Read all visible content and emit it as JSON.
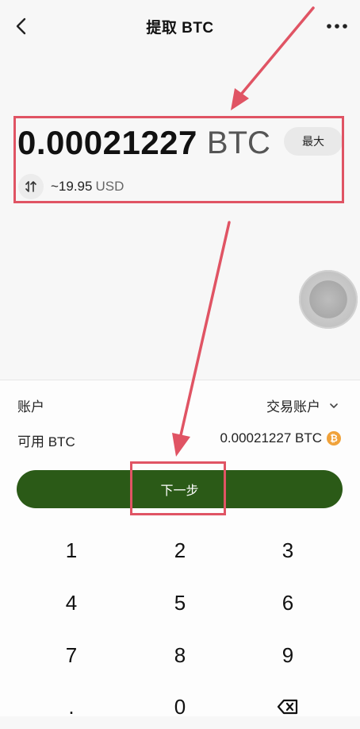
{
  "header": {
    "title": "提取 BTC",
    "back_icon": "chevron-left-icon",
    "more_icon": "more-dots-icon"
  },
  "amount": {
    "value": "0.00021227",
    "unit": "BTC",
    "max_label": "最大",
    "fiat_value": "~19.95",
    "fiat_currency": "USD",
    "swap_icon": "swap-vertical-icon"
  },
  "account": {
    "label": "账户",
    "selected": "交易账户",
    "available_label": "可用 BTC",
    "available_value": "0.00021227 BTC"
  },
  "next_button": {
    "label": "下一步"
  },
  "keypad": {
    "row1": [
      "1",
      "2",
      "3"
    ],
    "row2": [
      "4",
      "5",
      "6"
    ],
    "row3": [
      "7",
      "8",
      "9"
    ],
    "row4": [
      ".",
      "0",
      "backspace-icon"
    ]
  },
  "colors": {
    "primary_green": "#2b5a17",
    "annotation_red": "#e05464",
    "btc_orange": "#f0a23a"
  }
}
